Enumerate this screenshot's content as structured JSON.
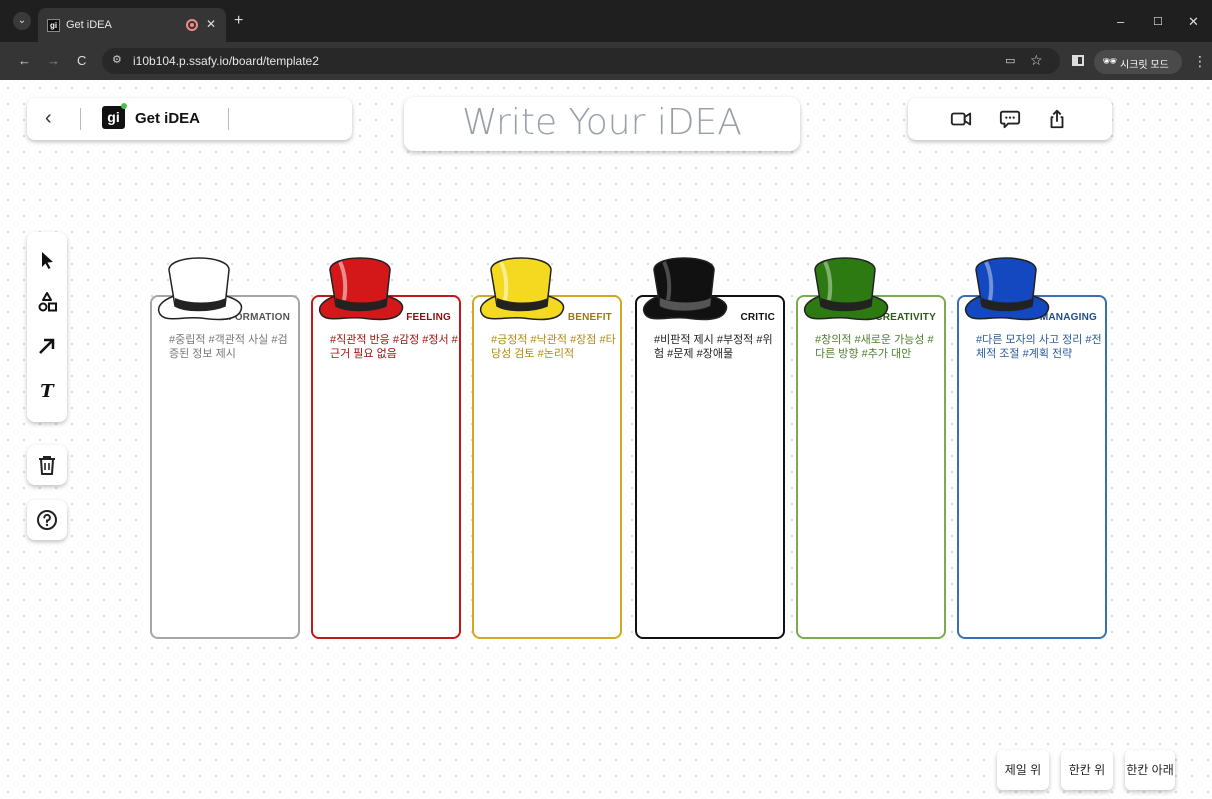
{
  "browser": {
    "tab_title": "Get iDEA",
    "tab_favicon_text": "gi",
    "url": "i10b104.p.ssafy.io/board/template2",
    "incognito_label": "시크릿 모드"
  },
  "header": {
    "brand": "Get iDEA",
    "logo_text": "gi",
    "title": "Write Your iDEA"
  },
  "bottom_buttons": {
    "top_most": "제일 위",
    "up_one": "한칸 위",
    "down_one": "한칸 아래"
  },
  "cards": [
    {
      "title": "INFORMATION",
      "tags": "#중립적 #객관적 사실 #검증된 정보 제시",
      "color": "#a6a6a6",
      "title_color": "#555555",
      "tag_color": "#777777",
      "hat_color": "#ffffff"
    },
    {
      "title": "FEELING",
      "tags": "#직관적 반응 #감정 #정서 #근거 필요 없음",
      "color": "#c0181b",
      "title_color": "#8b1010",
      "tag_color": "#a01010",
      "hat_color": "#d4181a"
    },
    {
      "title": "BENEFIT",
      "tags": "#긍정적 #낙관적 #장점 #타당성 검토 #논리적",
      "color": "#d4a820",
      "title_color": "#9a7a10",
      "tag_color": "#b08a14",
      "hat_color": "#f5d820"
    },
    {
      "title": "CRITIC",
      "tags": "#비판적 제시 #부정적 #위험 #문제 #장애물",
      "color": "#111111",
      "title_color": "#111111",
      "tag_color": "#222222",
      "hat_color": "#111111"
    },
    {
      "title": "CREATIVITY",
      "tags": "#창의적 #새로운 가능성 #다른 방향 #추가 대안",
      "color": "#7aac50",
      "title_color": "#2b5a14",
      "tag_color": "#4f7f30",
      "hat_color": "#2e7a12"
    },
    {
      "title": "MANAGING",
      "tags": "#다른 모자의 사고 정리 #전체적 조절 #계획 전략",
      "color": "#3a6fb5",
      "title_color": "#1f4b8a",
      "tag_color": "#2a5c9c",
      "hat_color": "#1348c0"
    }
  ]
}
